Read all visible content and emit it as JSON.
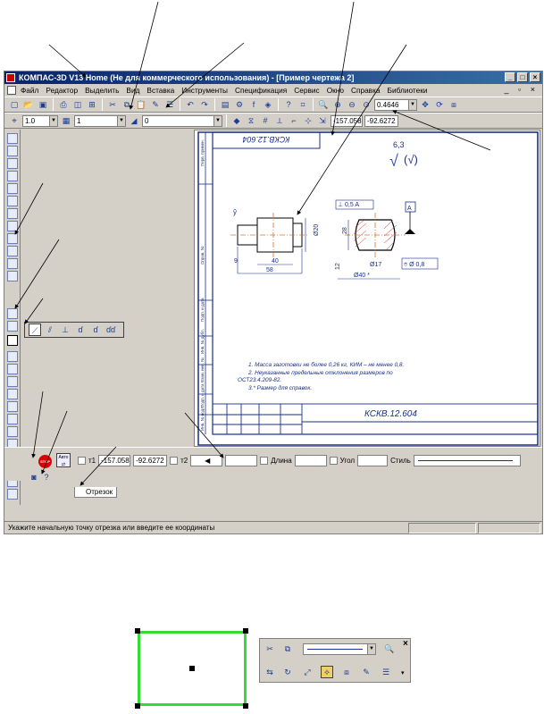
{
  "window": {
    "title": "КОМПАС-3D V13 Home (Не для коммерческого использования) - [Пример чертежа 2]"
  },
  "menu": [
    "Файл",
    "Редактор",
    "Выделить",
    "Вид",
    "Вставка",
    "Инструменты",
    "Спецификация",
    "Сервис",
    "Окно",
    "Справка",
    "Библиотеки"
  ],
  "toolbar1": {
    "zoom_value": "0.4646"
  },
  "toolbar2": {
    "step_value": "1.0",
    "layer_value": "1",
    "style_value": "0",
    "coord_x": "-157.058",
    "coord_y": "-92.6272"
  },
  "property_bar": {
    "t1_label": "т1",
    "t1_x": "-157.058",
    "t1_y": "-92.6272",
    "t2_label": "т2",
    "length_label": "Длина",
    "angle_label": "Угол",
    "style_label": "Стиль",
    "auto_label": "Авто",
    "stop_label": "STOP",
    "tab_label": "Отрезок"
  },
  "status": {
    "text": "Укажите начальную точку отрезка или введите ее координаты"
  },
  "drawing": {
    "stamp_top": "КСКВ.12.604",
    "stamp_bottom": "КСКВ.12.604",
    "roughness_value": "6,3",
    "roughness_mark": "(√)",
    "tolerance_label": "⊥ 0,5 A",
    "datum_label": "A",
    "runout_label": "⌾ Ø 0,8",
    "dim_40": "40",
    "dim_58": "58",
    "dim_9": "9",
    "dim_d20": "Ø20",
    "dim_28": "28",
    "dim_d17": "Ø17",
    "dim_d40": "Ø40 *",
    "dim_12": "12",
    "note_1": "1. Масса заготовки не более 0,26 кг, КИМ – не менее 0,8.",
    "note_2": "2. Неуказанные предельные отклонения размеров по",
    "note_2b": "ОСТ23.4.209-82.",
    "note_3": "3.* Размер для справок.",
    "side_labels": [
      "Перв. примен.",
      "Справ. №",
      "Подп. и дата",
      "Инв. № дубл.",
      "Взам. инв. №",
      "Подп. и дата",
      "Инв. № подл."
    ]
  },
  "colors": {
    "titlebar_start": "#0a246a",
    "titlebar_end": "#3a6ea5",
    "frame_blue": "#1a2f8a",
    "selection_green": "#33dd33"
  }
}
